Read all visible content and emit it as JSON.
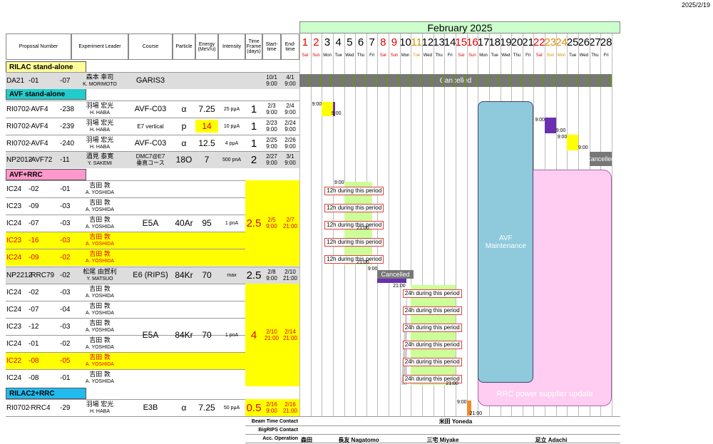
{
  "print_date": "2025/2/19",
  "month_title": "February 2025",
  "headers": {
    "proposal": "Proposal Number",
    "leader": "Experiment Leader",
    "course": "Course",
    "particle": "Particle",
    "energy": "Energy (MeV/u)",
    "intensity": "Intensity",
    "timeframe": "Time Frame (days)",
    "start": "Start-time",
    "end": "End-time"
  },
  "days": [
    "1",
    "2",
    "3",
    "4",
    "5",
    "6",
    "7",
    "8",
    "9",
    "10",
    "11",
    "12",
    "13",
    "14",
    "15",
    "16",
    "17",
    "18",
    "19",
    "20",
    "21",
    "22",
    "23",
    "24",
    "25",
    "26",
    "27",
    "28"
  ],
  "weekdays": [
    "Sat",
    "Sun",
    "Mon",
    "Tue",
    "Wed",
    "Thu",
    "Fri",
    "Sat",
    "Sun",
    "Mon",
    "Tue",
    "Wed",
    "Thu",
    "Fri",
    "Sat",
    "Sun",
    "Mon",
    "Tue",
    "Wed",
    "Thu",
    "Fri",
    "Sat",
    "Sun",
    "Mon",
    "Tue",
    "Wed",
    "Thu",
    "Fri"
  ],
  "day_colors": [
    "red",
    "red",
    "black",
    "black",
    "black",
    "black",
    "black",
    "red",
    "red",
    "black",
    "orange",
    "black",
    "black",
    "black",
    "red",
    "red",
    "black",
    "black",
    "black",
    "black",
    "black",
    "red",
    "orange",
    "orange",
    "black",
    "black",
    "black",
    "black"
  ],
  "sections": {
    "rilac": "RILAC stand-alone",
    "avf": "AVF stand-alone",
    "avfrrc": "AVF+RRC",
    "rilac2": "RILAC2+RRC"
  },
  "colors": {
    "rilac": "#ffff99",
    "avf": "#22cccc",
    "avfrrc": "#ff99cc",
    "rilac2": "#22bbee",
    "yellow": "#ffff00",
    "green": "#ccff99",
    "purple": "#6a2fb0",
    "maint": "#8ec9dc",
    "pink": "#ffccf2"
  },
  "rows": [
    {
      "p1": "DA21",
      "p2": "-01",
      "p3": "-07",
      "jp": "森本 幸司",
      "en": "K. MORIMOTO",
      "course": "GARIS3",
      "start": "10/1\n9:00",
      "end": "4/1\n9:00"
    },
    {
      "p1": "RI0702",
      "p2": "-AVF4",
      "p3": "-238",
      "jp": "羽場 宏光",
      "en": "H. HABA",
      "course": "AVF-C03",
      "particle": "α",
      "energy": "7.25",
      "intensity": "25 pμA",
      "tf": "1",
      "start": "2/3\n9:00",
      "end": "2/4\n9:00"
    },
    {
      "p1": "RI0702",
      "p2": "-AVF4",
      "p3": "-239",
      "jp": "羽場 宏光",
      "en": "H. HABA",
      "course": "E7 vertical",
      "particle": "p",
      "energy": "14",
      "intensity": "10 pμA",
      "tf": "1",
      "start": "2/23\n9:00",
      "end": "2/24\n9:00"
    },
    {
      "p1": "RI0702",
      "p2": "-AVF4",
      "p3": "-240",
      "jp": "羽場 宏光",
      "en": "H. HABA",
      "course": "AVF-C03",
      "particle": "α",
      "energy": "12.5",
      "intensity": "4 pμA",
      "tf": "1",
      "start": "2/25\n9:00",
      "end": "2/26\n9:00"
    },
    {
      "p1": "NP2012",
      "p2": "-AVF72",
      "p3": "-11",
      "jp": "酒見 泰寛",
      "en": "Y. SAKEMI",
      "course": "DMC7@E7\n垂直コース",
      "particle": "18O",
      "energy": "7",
      "intensity": "500 pnA",
      "tf": "2",
      "start": "2/27\n9:00",
      "end": "3/1\n9:00"
    },
    {
      "p1": "IC24",
      "p2": "-02",
      "p3": "-01",
      "jp": "吉田 敦",
      "en": "A. YOSHIDA"
    },
    {
      "p1": "IC23",
      "p2": "-09",
      "p3": "-03",
      "jp": "吉田 敦",
      "en": "A. YOSHIDA"
    },
    {
      "p1": "IC24",
      "p2": "-07",
      "p3": "-03",
      "jp": "吉田 敦",
      "en": "A. YOSHIDA"
    },
    {
      "p1": "IC23",
      "p2": "-16",
      "p3": "-03",
      "jp": "吉田 敦",
      "en": "A. YOSHIDA"
    },
    {
      "p1": "IC24",
      "p2": "-09",
      "p3": "-02",
      "jp": "吉田 敦",
      "en": "A. YOSHIDA"
    },
    {
      "p1": "NP2212",
      "p2": "-RRC79",
      "p3": "-02",
      "jp": "松尾 由賀利",
      "en": "Y. MATSUO",
      "course": "E6 (RIPS)",
      "particle": "84Kr",
      "energy": "70",
      "intensity": "max",
      "tf": "2.5",
      "start": "2/8\n9:00",
      "end": "2/10\n21:00"
    },
    {
      "p1": "IC24",
      "p2": "-02",
      "p3": "-03",
      "jp": "吉田 敦",
      "en": "A. YOSHIDA"
    },
    {
      "p1": "IC24",
      "p2": "-07",
      "p3": "-04",
      "jp": "吉田 敦",
      "en": "A. YOSHIDA"
    },
    {
      "p1": "IC23",
      "p2": "-12",
      "p3": "-03",
      "jp": "吉田 敦",
      "en": "A. YOSHIDA"
    },
    {
      "p1": "IC24",
      "p2": "-01",
      "p3": "-02",
      "jp": "吉田 敦",
      "en": "A. YOSHIDA"
    },
    {
      "p1": "IC22",
      "p2": "-08",
      "p3": "-05",
      "jp": "吉田 敦",
      "en": "A. YOSHIDA"
    },
    {
      "p1": "IC24",
      "p2": "-08",
      "p3": "-01",
      "jp": "吉田 敦",
      "en": "A. YOSHIDA"
    },
    {
      "p1": "RI0702",
      "p2": "-RRC4",
      "p3": "-29",
      "jp": "羽場 宏光",
      "en": "H. HABA",
      "course": "E3B",
      "particle": "α",
      "energy": "7.25",
      "intensity": "50 pμA",
      "tf": "0.5",
      "start": "2/16\n9:00",
      "end": "2/16\n21:00"
    }
  ],
  "group1": {
    "course": "E5A",
    "particle": "40Ar",
    "energy": "95",
    "intensity": "1 pnA",
    "tf": "2.5",
    "start": "2/5\n9:00",
    "end": "2/7\n21:00"
  },
  "group2": {
    "course": "E5A",
    "particle": "84Kr",
    "energy": "70",
    "intensity": "1 pnA",
    "tf": "4",
    "start": "2/10\n21:00",
    "end": "2/14\n21:00"
  },
  "labels": {
    "cancelled": "Cancelled",
    "note12": "12h during this period",
    "note24": "24h during this period",
    "avf_maint": "AVF\nMaintenance",
    "rrc_update": "RRC power supplier update",
    "t900": "9:00",
    "t2100": "21:00"
  },
  "contacts": {
    "beamtime_label": "Beam Time Contact",
    "beamtime": "米田 Yoneda",
    "bigrips_label": "BigRIPS Contact",
    "acc_label": "Acc. Operation",
    "acc": [
      "森田",
      "長友 Nagatomo",
      "三宅 Miyake",
      "足立 Adachi"
    ]
  }
}
